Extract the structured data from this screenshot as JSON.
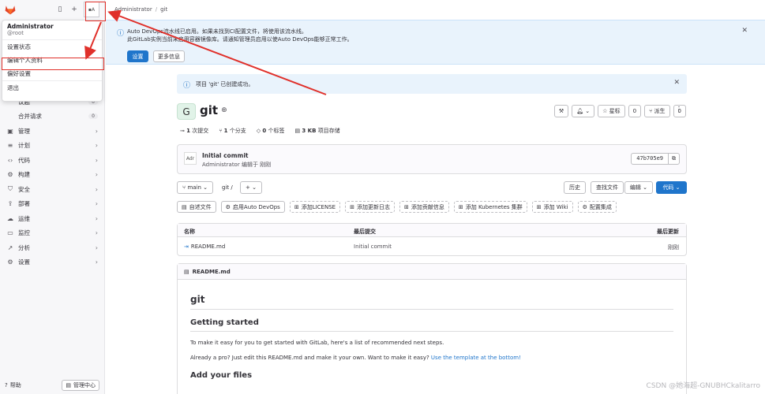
{
  "sidebar": {
    "nav": [
      {
        "icon": "issues-icon",
        "label": "议题",
        "count": "0"
      },
      {
        "label": "合并请求",
        "count": "0"
      },
      {
        "icon": "briefcase-icon",
        "label": "管理"
      },
      {
        "icon": "calendar-icon",
        "label": "计划"
      },
      {
        "icon": "code-icon",
        "label": "代码"
      },
      {
        "icon": "rocket-icon",
        "label": "构建"
      },
      {
        "icon": "shield-icon",
        "label": "安全"
      },
      {
        "icon": "deploy-icon",
        "label": "部署"
      },
      {
        "icon": "monitor-icon",
        "label": "运维"
      },
      {
        "icon": "chart-icon",
        "label": "监控"
      },
      {
        "icon": "analytics-icon",
        "label": "分析"
      },
      {
        "icon": "gear-icon",
        "label": "设置"
      }
    ],
    "help_label": "帮助",
    "admin_label": "管理中心"
  },
  "user_menu": {
    "name": "Administrator",
    "handle": "@root",
    "items": [
      "设置状态",
      "编辑个人资料",
      "偏好设置",
      "退出"
    ]
  },
  "breadcrumb": {
    "root": "Administrator",
    "sep": "/",
    "current": "git"
  },
  "autodevops_alert": {
    "line1": "Auto DevOps流水线已启用。如果未找到CI配置文件，将使用该流水线。",
    "line2": "此GitLab实例当前未启用容器镜像库。请通知管理员启用以使Auto DevOps能够正常工作。",
    "btn_settings": "设置",
    "btn_more": "更多信息"
  },
  "success_alert": {
    "text": "项目 'git' 已创建成功。"
  },
  "project": {
    "avatar_letter": "G",
    "name": "git",
    "star_label": "星标",
    "star_count": "0",
    "fork_label": "派生",
    "fork_count": "0"
  },
  "stats": {
    "commits_num": "1",
    "commits_label": "次提交",
    "branches_num": "1",
    "branches_label": "个分支",
    "tags_num": "0",
    "tags_label": "个标签",
    "storage_num": "3 KB",
    "storage_label": "项目存储"
  },
  "commit": {
    "avatar_alt": "Adr",
    "title": "Initial commit",
    "meta": "Administrator 编辑于 刚刚",
    "sha": "47b705e9"
  },
  "toolbar": {
    "branch": "main",
    "path": "git /",
    "history": "历史",
    "find_file": "查找文件",
    "edit": "编辑",
    "code": "代码"
  },
  "quick_actions": [
    "自述文件",
    "启用Auto DevOps",
    "添加LICENSE",
    "添加更新日志",
    "添加贡献信息",
    "添加 Kubernetes 集群",
    "添加 Wiki",
    "配置集成"
  ],
  "files": {
    "headers": [
      "名称",
      "最后提交",
      "最后更新"
    ],
    "rows": [
      {
        "name": "README.md",
        "commit": "Initial commit",
        "updated": "刚刚"
      }
    ]
  },
  "readme": {
    "title": "README.md",
    "h1": "git",
    "h2": "Getting started",
    "p1": "To make it easy for you to get started with GitLab, here's a list of recommended next steps.",
    "p2": "Already a pro? Just edit this README.md and make it your own. Want to make it easy?",
    "p2_link": "Use the template at the bottom!",
    "h3": "Add your files"
  },
  "watermark": "CSDN @她海超-GNUBHCkalitarro",
  "colors": {
    "primary": "#1f75cb",
    "annotation": "#e0302a",
    "info_bg": "#e9f3fc"
  }
}
